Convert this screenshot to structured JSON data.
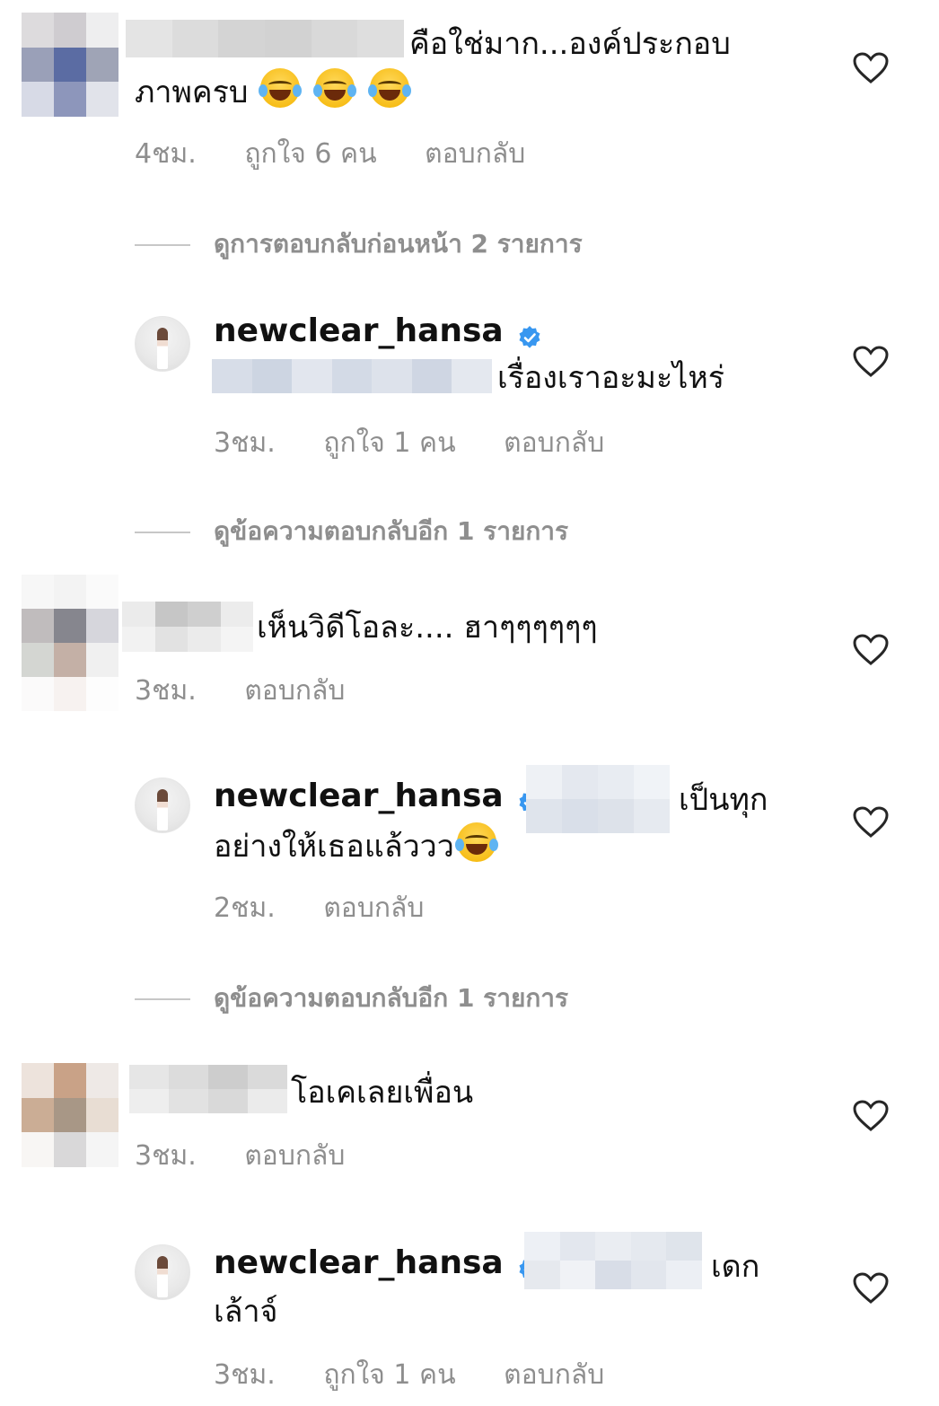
{
  "comments": [
    {
      "text_line1": "คือใช่มาก...องค์ประกอบ",
      "text_line2": "ภาพครบ",
      "emoji": "face-with-tears-of-joy x3",
      "time": "4ชม.",
      "likes": "ถูกใจ 6 คน",
      "reply": "ตอบกลับ",
      "view_replies": "ดูการตอบกลับก่อนหน้า 2 รายการ",
      "reply_item": {
        "username": "newclear_hansa",
        "text": "เรื่องเราอะมะไหร่",
        "time": "3ชม.",
        "likes": "ถูกใจ 1 คน",
        "reply": "ตอบกลับ"
      }
    },
    {
      "text": "เห็นวิดีโอละ.... ฮาๆๆๆๆๆๆ",
      "time": "3ชม.",
      "reply": "ตอบกลับ",
      "reply_item": {
        "username": "newclear_hansa",
        "text_line1": "เป็นทุก",
        "text_line2": "อย่างให้เธอแล้ววว",
        "emoji": "face-with-tears-of-joy",
        "time": "2ชม.",
        "reply": "ตอบกลับ"
      },
      "view_replies": "ดูข้อความตอบกลับอีก 1 รายการ"
    },
    {
      "text": "โอเคเลยเพื่อน",
      "time": "3ชม.",
      "reply": "ตอบกลับ",
      "reply_item": {
        "username": "newclear_hansa",
        "text_line1": "เดก",
        "text_line2": "เล้าจ์",
        "time": "3ชม.",
        "likes": "ถูกใจ 1 คน",
        "reply": "ตอบกลับ"
      }
    }
  ],
  "view_replies_2": "ดูข้อความตอบกลับอีก 1 รายการ",
  "icons": {
    "like": "heart-outline-icon",
    "verified": "verified-badge-icon"
  },
  "colors": {
    "text": "#111111",
    "meta": "#8e8e8e",
    "verified": "#3897f0",
    "divider": "#c7c7c7"
  }
}
